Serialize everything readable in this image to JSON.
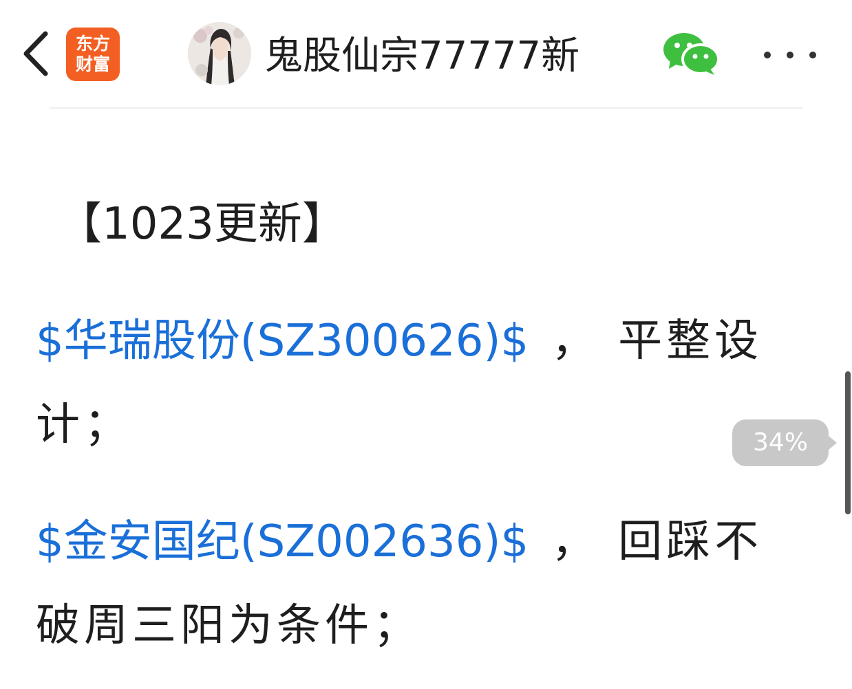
{
  "header": {
    "logo_line1": "东方",
    "logo_line2": "财富",
    "account_name": "鬼股仙宗77777新",
    "icons": {
      "back": "chevron-left-icon",
      "share_wechat": "wechat-icon",
      "more": "more-dots-icon"
    }
  },
  "article": {
    "heading": "【1023更新】",
    "entries": [
      {
        "stock": "$华瑞股份(SZ300626)$",
        "separator": "，",
        "text_line1": "平整设",
        "text_line2": "计；"
      },
      {
        "stock": "$金安国纪(SZ002636)$",
        "separator": "，",
        "text_line1": "回踩不",
        "text_line2": "破周三阳为条件；"
      }
    ]
  },
  "scroll": {
    "percent_label": "34%",
    "percent": 0.34
  },
  "colors": {
    "brand": "#f35f22",
    "link": "#1a6fd8",
    "wechat": "#3fbf3f",
    "badge": "#c8c8c8"
  }
}
